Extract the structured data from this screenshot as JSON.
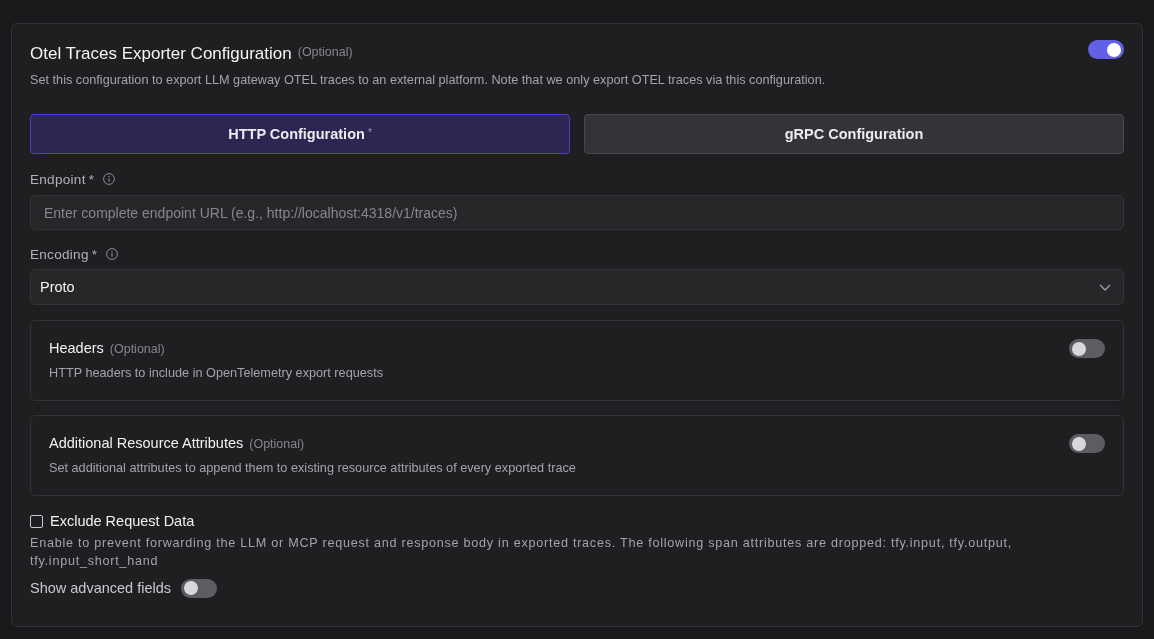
{
  "section": {
    "title": "Otel Traces Exporter Configuration",
    "optional_tag": "(Optional)",
    "enabled": true,
    "description": "Set this configuration to export LLM gateway OTEL traces to an external platform. Note that we only export OTEL traces via this configuration."
  },
  "tabs": [
    {
      "label": "HTTP Configuration",
      "required_mark": "*",
      "selected": true
    },
    {
      "label": "gRPC Configuration",
      "selected": false
    }
  ],
  "fields": [
    {
      "kind": "input",
      "label": "Endpoint",
      "required_mark": "*",
      "placeholder": "Enter complete endpoint URL (e.g., http://localhost:4318/v1/traces)"
    },
    {
      "kind": "select",
      "label": "Encoding",
      "required_mark": "*",
      "value": "Proto"
    }
  ],
  "toggle_cards": [
    {
      "title": "Headers",
      "optional_tag": "(Optional)",
      "description": "HTTP headers to include in OpenTelemetry export requests",
      "on": false
    },
    {
      "title": "Additional Resource Attributes",
      "optional_tag": "(Optional)",
      "description": "Set additional attributes to append them to existing resource attributes of every exported trace",
      "on": false
    }
  ],
  "exclude_request_data": {
    "label": "Exclude Request Data",
    "checked": false,
    "description": "Enable to prevent forwarding the LLM or MCP request and response body in exported traces. The following span attributes are dropped: tfy.input, tfy.output, tfy.input_short_hand"
  },
  "advanced_fields": {
    "label": "Show advanced fields",
    "on": false
  }
}
